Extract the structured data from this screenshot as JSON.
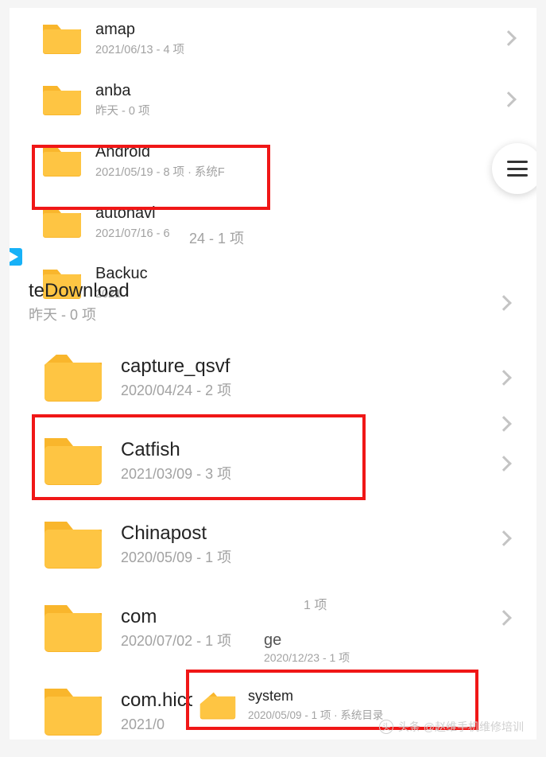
{
  "main_list": [
    {
      "name": "amap",
      "sub": "2021/06/13 - 4 项"
    },
    {
      "name": "anba",
      "sub": "昨天 - 0 项"
    },
    {
      "name": "Android",
      "sub": "2021/05/19 - 8 项 · 系统F"
    },
    {
      "name": "autonavi",
      "sub": "2021/07/16 - 6"
    },
    {
      "name": "Backuc",
      "sub": "2021"
    }
  ],
  "overlay_upper": {
    "partial_sub": "24 - 1 项",
    "row1": {
      "name": "teDownload",
      "sub": "昨天 - 0 项"
    },
    "row2": {
      "name": "capture_qsvf",
      "sub": "2020/04/24 - 2 项"
    },
    "row3": {
      "name": "Catfish",
      "sub": "2021/03/09 - 3 项"
    },
    "row4": {
      "name": "Chinapost",
      "sub": "2020/05/09 - 1 项"
    },
    "row5": {
      "name": "com",
      "sub": "2020/07/02 - 1 项"
    },
    "row6": {
      "name": "com.hicorerMS",
      "sub": "2021/0"
    }
  },
  "overlay_middle": {
    "orphan_count": "1 项",
    "row_ge": {
      "name": "ge",
      "sub": "2020/12/23 - 1 项"
    }
  },
  "popup_system": {
    "name": "system",
    "sub": "2020/05/09 - 1 项 · 系统目录"
  },
  "attribution": "头条 @赵维手机维修培训"
}
